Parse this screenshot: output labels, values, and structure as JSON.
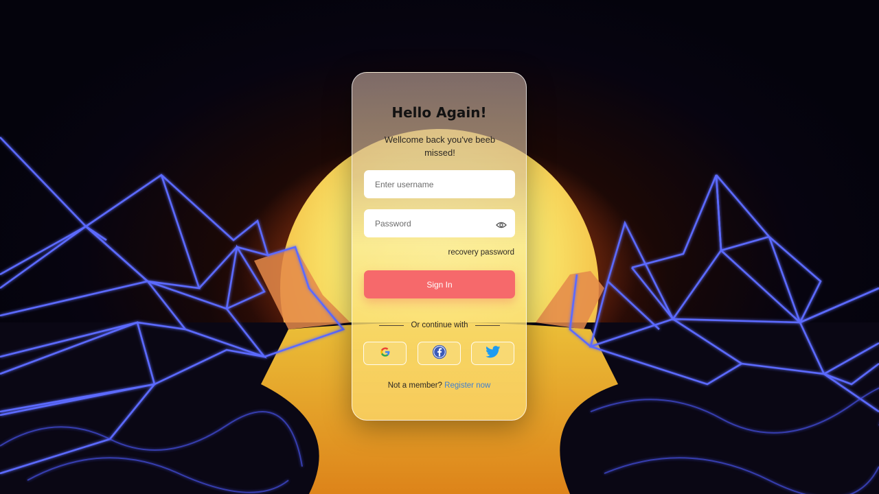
{
  "login": {
    "title": "Hello Again!",
    "subtitle": "Wellcome back you've beeb missed!",
    "username_placeholder": "Enter username",
    "password_placeholder": "Password",
    "recovery_label": "recovery password",
    "signin_label": "Sign In",
    "divider_label": "Or continue with",
    "footer_text": "Not a member?",
    "register_label": "Register now"
  },
  "icons": {
    "password_toggle": "eye-icon",
    "social": [
      "google-icon",
      "facebook-icon",
      "twitter-icon"
    ]
  },
  "colors": {
    "signin_button": "#f6696b",
    "register_link": "#3f7fd0",
    "neon_lines": "#4b5cff",
    "sun": "#f7e06a"
  }
}
